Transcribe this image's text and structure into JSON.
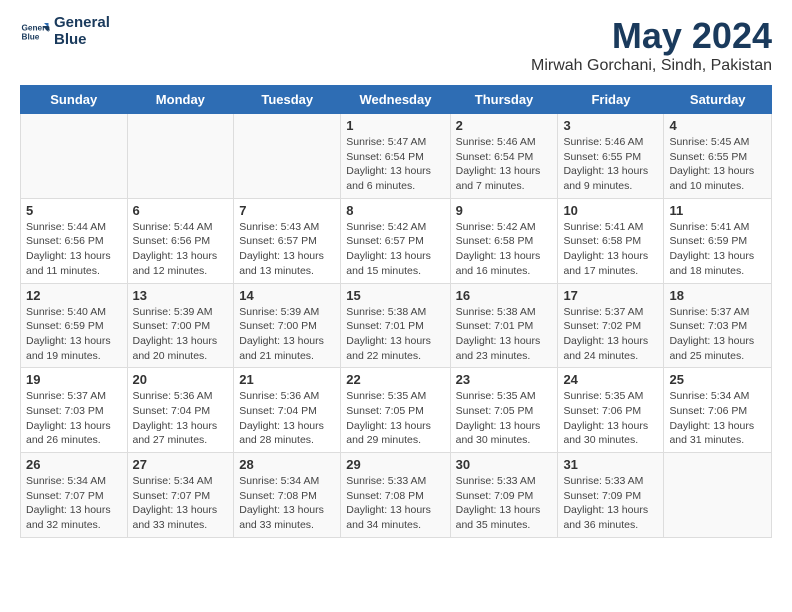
{
  "header": {
    "logo_line1": "General",
    "logo_line2": "Blue",
    "month": "May 2024",
    "location": "Mirwah Gorchani, Sindh, Pakistan"
  },
  "columns": [
    "Sunday",
    "Monday",
    "Tuesday",
    "Wednesday",
    "Thursday",
    "Friday",
    "Saturday"
  ],
  "weeks": [
    [
      {
        "day": "",
        "info": ""
      },
      {
        "day": "",
        "info": ""
      },
      {
        "day": "",
        "info": ""
      },
      {
        "day": "1",
        "info": "Sunrise: 5:47 AM\nSunset: 6:54 PM\nDaylight: 13 hours and 6 minutes."
      },
      {
        "day": "2",
        "info": "Sunrise: 5:46 AM\nSunset: 6:54 PM\nDaylight: 13 hours and 7 minutes."
      },
      {
        "day": "3",
        "info": "Sunrise: 5:46 AM\nSunset: 6:55 PM\nDaylight: 13 hours and 9 minutes."
      },
      {
        "day": "4",
        "info": "Sunrise: 5:45 AM\nSunset: 6:55 PM\nDaylight: 13 hours and 10 minutes."
      }
    ],
    [
      {
        "day": "5",
        "info": "Sunrise: 5:44 AM\nSunset: 6:56 PM\nDaylight: 13 hours and 11 minutes."
      },
      {
        "day": "6",
        "info": "Sunrise: 5:44 AM\nSunset: 6:56 PM\nDaylight: 13 hours and 12 minutes."
      },
      {
        "day": "7",
        "info": "Sunrise: 5:43 AM\nSunset: 6:57 PM\nDaylight: 13 hours and 13 minutes."
      },
      {
        "day": "8",
        "info": "Sunrise: 5:42 AM\nSunset: 6:57 PM\nDaylight: 13 hours and 15 minutes."
      },
      {
        "day": "9",
        "info": "Sunrise: 5:42 AM\nSunset: 6:58 PM\nDaylight: 13 hours and 16 minutes."
      },
      {
        "day": "10",
        "info": "Sunrise: 5:41 AM\nSunset: 6:58 PM\nDaylight: 13 hours and 17 minutes."
      },
      {
        "day": "11",
        "info": "Sunrise: 5:41 AM\nSunset: 6:59 PM\nDaylight: 13 hours and 18 minutes."
      }
    ],
    [
      {
        "day": "12",
        "info": "Sunrise: 5:40 AM\nSunset: 6:59 PM\nDaylight: 13 hours and 19 minutes."
      },
      {
        "day": "13",
        "info": "Sunrise: 5:39 AM\nSunset: 7:00 PM\nDaylight: 13 hours and 20 minutes."
      },
      {
        "day": "14",
        "info": "Sunrise: 5:39 AM\nSunset: 7:00 PM\nDaylight: 13 hours and 21 minutes."
      },
      {
        "day": "15",
        "info": "Sunrise: 5:38 AM\nSunset: 7:01 PM\nDaylight: 13 hours and 22 minutes."
      },
      {
        "day": "16",
        "info": "Sunrise: 5:38 AM\nSunset: 7:01 PM\nDaylight: 13 hours and 23 minutes."
      },
      {
        "day": "17",
        "info": "Sunrise: 5:37 AM\nSunset: 7:02 PM\nDaylight: 13 hours and 24 minutes."
      },
      {
        "day": "18",
        "info": "Sunrise: 5:37 AM\nSunset: 7:03 PM\nDaylight: 13 hours and 25 minutes."
      }
    ],
    [
      {
        "day": "19",
        "info": "Sunrise: 5:37 AM\nSunset: 7:03 PM\nDaylight: 13 hours and 26 minutes."
      },
      {
        "day": "20",
        "info": "Sunrise: 5:36 AM\nSunset: 7:04 PM\nDaylight: 13 hours and 27 minutes."
      },
      {
        "day": "21",
        "info": "Sunrise: 5:36 AM\nSunset: 7:04 PM\nDaylight: 13 hours and 28 minutes."
      },
      {
        "day": "22",
        "info": "Sunrise: 5:35 AM\nSunset: 7:05 PM\nDaylight: 13 hours and 29 minutes."
      },
      {
        "day": "23",
        "info": "Sunrise: 5:35 AM\nSunset: 7:05 PM\nDaylight: 13 hours and 30 minutes."
      },
      {
        "day": "24",
        "info": "Sunrise: 5:35 AM\nSunset: 7:06 PM\nDaylight: 13 hours and 30 minutes."
      },
      {
        "day": "25",
        "info": "Sunrise: 5:34 AM\nSunset: 7:06 PM\nDaylight: 13 hours and 31 minutes."
      }
    ],
    [
      {
        "day": "26",
        "info": "Sunrise: 5:34 AM\nSunset: 7:07 PM\nDaylight: 13 hours and 32 minutes."
      },
      {
        "day": "27",
        "info": "Sunrise: 5:34 AM\nSunset: 7:07 PM\nDaylight: 13 hours and 33 minutes."
      },
      {
        "day": "28",
        "info": "Sunrise: 5:34 AM\nSunset: 7:08 PM\nDaylight: 13 hours and 33 minutes."
      },
      {
        "day": "29",
        "info": "Sunrise: 5:33 AM\nSunset: 7:08 PM\nDaylight: 13 hours and 34 minutes."
      },
      {
        "day": "30",
        "info": "Sunrise: 5:33 AM\nSunset: 7:09 PM\nDaylight: 13 hours and 35 minutes."
      },
      {
        "day": "31",
        "info": "Sunrise: 5:33 AM\nSunset: 7:09 PM\nDaylight: 13 hours and 36 minutes."
      },
      {
        "day": "",
        "info": ""
      }
    ]
  ]
}
